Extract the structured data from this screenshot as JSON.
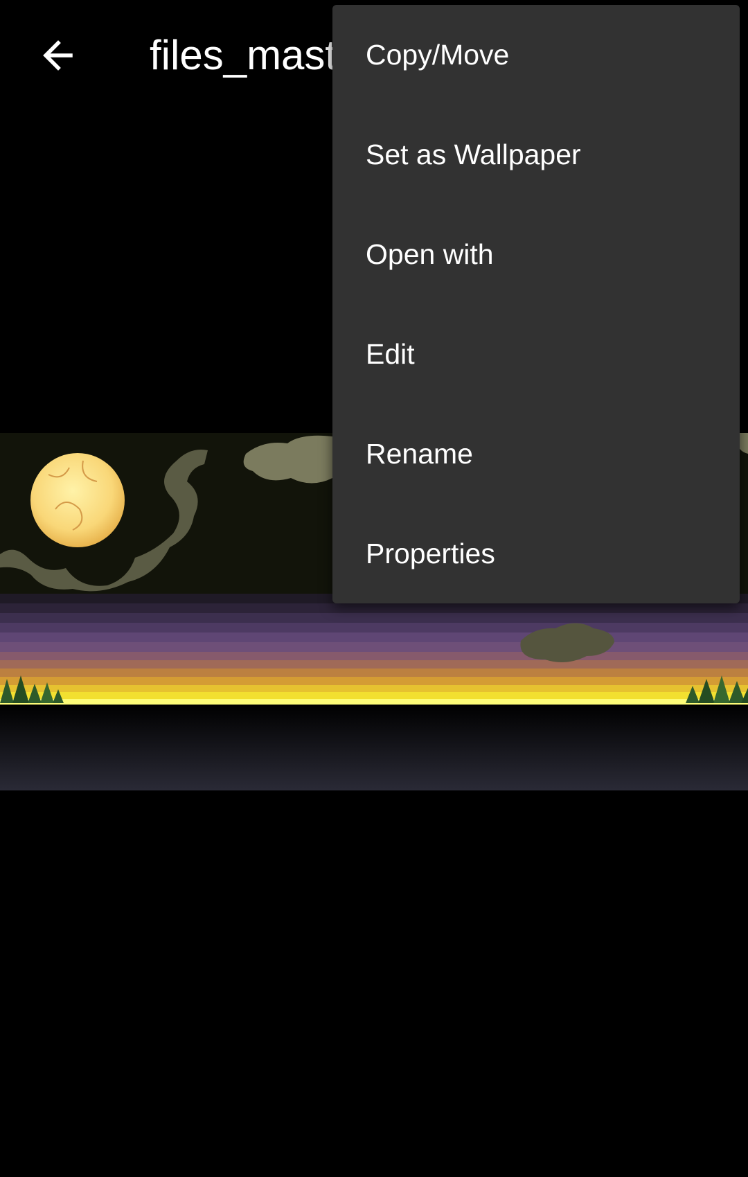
{
  "app_bar": {
    "title": "files_master"
  },
  "icons": {
    "back": "arrow-left-icon"
  },
  "menu": {
    "items": [
      {
        "label": "Copy/Move"
      },
      {
        "label": "Set as Wallpaper"
      },
      {
        "label": "Open with"
      },
      {
        "label": "Edit"
      },
      {
        "label": "Rename"
      },
      {
        "label": "Properties"
      }
    ]
  },
  "colors": {
    "background": "#000000",
    "menu_background": "#323232",
    "text": "#ffffff"
  }
}
